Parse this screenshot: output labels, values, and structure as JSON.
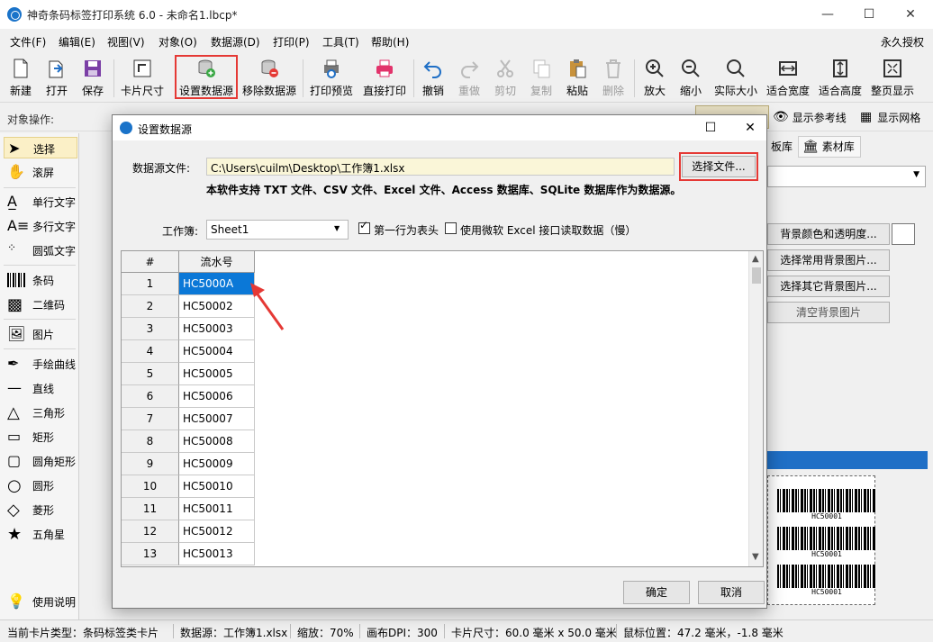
{
  "window": {
    "title": "神奇条码标签打印系统 6.0 - 未命名1.lbcp*",
    "min": "—",
    "max": "☐",
    "close": "✕"
  },
  "menubar": {
    "items": [
      "文件(F)",
      "编辑(E)",
      "视图(V)",
      "对象(O)",
      "数据源(D)",
      "打印(P)",
      "工具(T)",
      "帮助(H)"
    ],
    "license": "永久授权"
  },
  "toolbar": {
    "buttons": [
      "新建",
      "打开",
      "保存",
      "卡片尺寸",
      "设置数据源",
      "移除数据源",
      "打印预览",
      "直接打印",
      "撤销",
      "重做",
      "剪切",
      "复制",
      "粘贴",
      "删除",
      "放大",
      "缩小",
      "实际大小",
      "适合宽度",
      "适合高度",
      "整页显示"
    ]
  },
  "objops": {
    "label": "对象操作:",
    "ref_line": "显示参考线",
    "grid": "显示网格"
  },
  "tools": [
    "选择",
    "滚屏",
    "单行文字",
    "多行文字",
    "圆弧文字",
    "条码",
    "二维码",
    "图片",
    "手绘曲线",
    "直线",
    "三角形",
    "矩形",
    "圆角矩形",
    "圆形",
    "菱形",
    "五角星",
    "使用说明"
  ],
  "rightpanel": {
    "tab_lib": "板库",
    "tab_material": "素材库",
    "btn_bg_color": "背景颜色和透明度...",
    "btn_common_bg": "选择常用背景图片...",
    "btn_other_bg": "选择其它背景图片...",
    "btn_clear_bg": "清空背景图片",
    "preview_code": "HC50001"
  },
  "dialog": {
    "title": "设置数据源",
    "src_label": "数据源文件:",
    "src_path": "C:\\Users\\cuilm\\Desktop\\工作簿1.xlsx",
    "choose_file": "选择文件...",
    "note": "本软件支持 TXT 文件、CSV 文件、Excel 文件、Access 数据库、SQLite 数据库作为数据源。",
    "workbook_label": "工作簿:",
    "workbook_value": "Sheet1",
    "chk_header": "第一行为表头",
    "chk_ms": "使用微软 Excel 接口读取数据（慢）",
    "grid_header_num": "#",
    "grid_header_col": "流水号",
    "rows": [
      [
        "1",
        "HC5000A"
      ],
      [
        "2",
        "HC50002"
      ],
      [
        "3",
        "HC50003"
      ],
      [
        "4",
        "HC50004"
      ],
      [
        "5",
        "HC50005"
      ],
      [
        "6",
        "HC50006"
      ],
      [
        "7",
        "HC50007"
      ],
      [
        "8",
        "HC50008"
      ],
      [
        "9",
        "HC50009"
      ],
      [
        "10",
        "HC50010"
      ],
      [
        "11",
        "HC50011"
      ],
      [
        "12",
        "HC50012"
      ],
      [
        "13",
        "HC50013"
      ]
    ],
    "ok": "确定",
    "cancel": "取消"
  },
  "statusbar": {
    "card_type": "当前卡片类型：条码标签类卡片",
    "datasource": "数据源：工作簿1.xlsx",
    "zoom": "缩放：70%",
    "dpi": "画布DPI：300",
    "card_size": "卡片尺寸：60.0 毫米 x 50.0 毫米",
    "mouse": "鼠标位置：47.2 毫米，-1.8 毫米"
  }
}
